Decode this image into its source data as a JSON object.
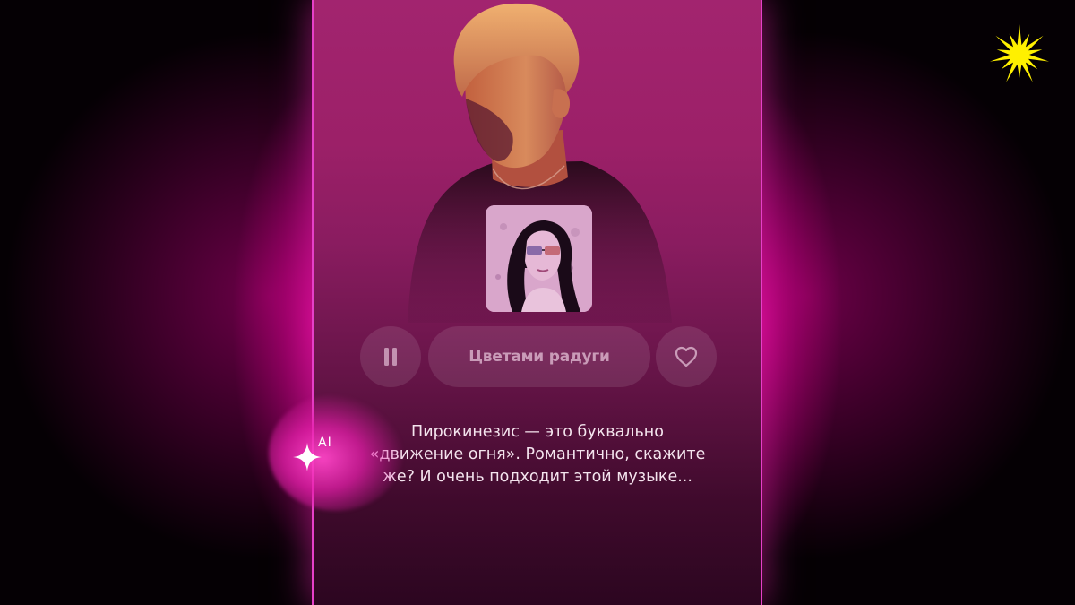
{
  "player": {
    "track_title": "Цветами радуги",
    "ai_comment": {
      "lines": [
        "Пирокинезис — это буквально",
        "«движение огня». Романтично, скажите",
        "же? И очень подходит этой музыке..."
      ]
    },
    "ai_badge": "AI",
    "pause_icon": "pause-icon",
    "like_icon": "heart-icon",
    "cover_icon": "album-cover",
    "ai_icon": "sparkle-icon"
  },
  "brand": {
    "icon": "sunburst-logo",
    "color": "#fff000"
  },
  "colors": {
    "accent": "#e640c8",
    "panel_top": "#a2246f",
    "panel_bottom": "#2c0620"
  }
}
